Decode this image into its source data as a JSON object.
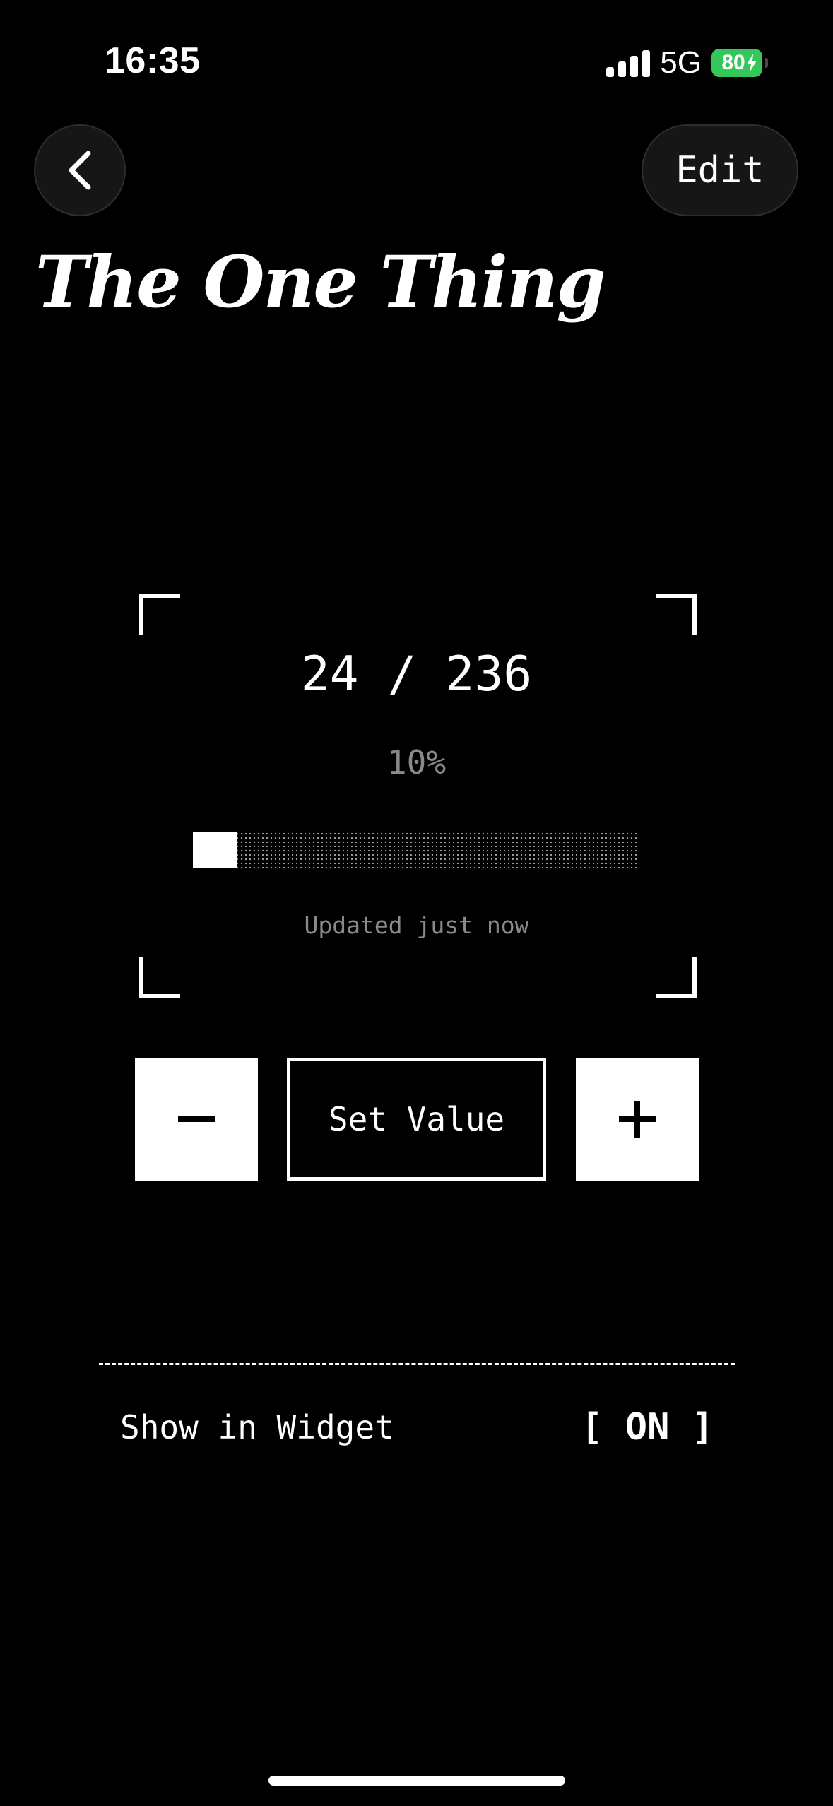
{
  "status_bar": {
    "time": "16:35",
    "network": "5G",
    "battery_percent": "80",
    "battery_color": "#34c759",
    "signal_icon": "cellular-signal-icon",
    "charging_icon": "charging-bolt-icon"
  },
  "nav": {
    "back_icon": "chevron-left-icon",
    "edit_label": "Edit"
  },
  "page_title": "The One Thing",
  "progress": {
    "current": 24,
    "total": 236,
    "count_text": "24 / 236",
    "percent_text": "10%",
    "fraction": 0.1,
    "updated_text": "Updated just now"
  },
  "controls": {
    "minus_icon": "minus-icon",
    "set_value_label": "Set Value",
    "plus_icon": "plus-icon"
  },
  "settings": {
    "show_in_widget_label": "Show in Widget",
    "show_in_widget_value": "[ ON ]"
  }
}
